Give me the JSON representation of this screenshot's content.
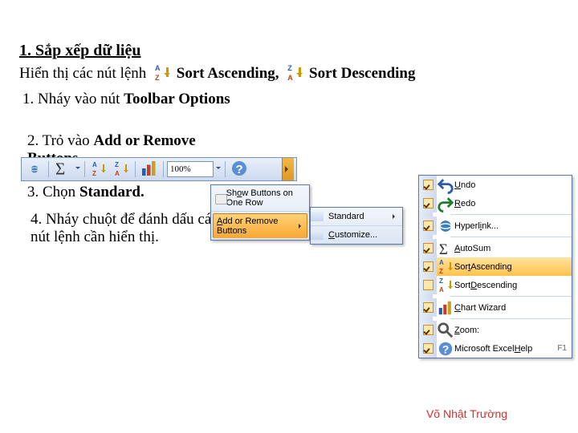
{
  "title": "1. Sắp xếp dữ liệu",
  "intro_prefix": "Hiển thị các nút lệnh",
  "sort_asc_label": "Sort Ascending,",
  "sort_desc_label": "Sort Descending",
  "steps": {
    "s1_pre": "1. Nháy vào nút ",
    "s1_bold": "Toolbar Options",
    "s2_pre": "2. Trỏ vào ",
    "s2_bold": "Add or Remove Buttons",
    "s3_pre": "3. Chọn ",
    "s3_bold": "Standard.",
    "s4": "4. Nháy chuột để đánh dấu các nút lệnh cần hiển thị."
  },
  "toolbar": {
    "zoom": "100%"
  },
  "popup1": {
    "row1_pre": "Sh",
    "row1_u": "o",
    "row1_post": "w Buttons on One Row",
    "row2_u": "A",
    "row2_post": "dd or Remove Buttons"
  },
  "popup2": {
    "standard": "Standard",
    "customize_u": "C",
    "customize_post": "ustomize..."
  },
  "cmdlist": [
    {
      "checked": true,
      "icon": "undo",
      "label": "Undo"
    },
    {
      "checked": true,
      "icon": "redo",
      "label": "Redo"
    },
    {
      "sep": true
    },
    {
      "checked": true,
      "icon": "link",
      "label_pre": "Hyperl",
      "label_u": "i",
      "label_post": "nk..."
    },
    {
      "sep": true
    },
    {
      "checked": true,
      "icon": "sigma",
      "label": "AutoSum"
    },
    {
      "checked": true,
      "icon": "sortasc",
      "highlight": true,
      "label_pre": "Sor",
      "label_u": "t",
      "label_post": " Ascending"
    },
    {
      "checked": false,
      "icon": "sortdesc",
      "label_pre": "Sor",
      "label_post": "t ",
      "label_u2": "D",
      "label_post2": "escending"
    },
    {
      "sep": true
    },
    {
      "checked": true,
      "icon": "chart",
      "label_u": "C",
      "label_post": "hart Wizard"
    },
    {
      "sep": true
    },
    {
      "checked": true,
      "icon": "zoom",
      "label_u": "Z",
      "label_post": "oom:"
    },
    {
      "checked": true,
      "icon": "help",
      "label_pre": "Microsoft Excel ",
      "label_u": "H",
      "label_post": "elp",
      "kb": "F1"
    }
  ],
  "footer": "Võ Nhật Trường"
}
